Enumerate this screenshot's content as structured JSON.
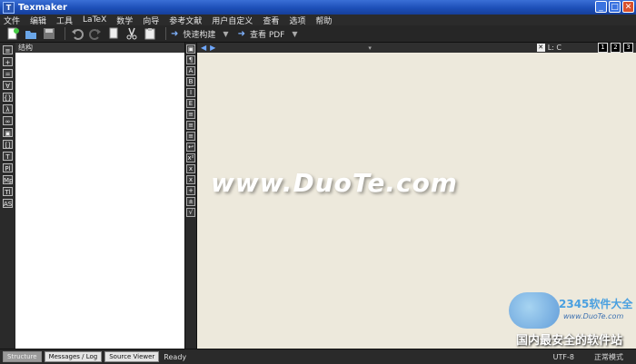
{
  "window": {
    "title": "Texmaker",
    "app_icon": "T",
    "min": "_",
    "max": "□",
    "close": "✕"
  },
  "menu": [
    "文件",
    "编辑",
    "工具",
    "LaTeX",
    "数学",
    "向导",
    "参考文献",
    "用户自定义",
    "查看",
    "选项",
    "帮助"
  ],
  "toolbar": {
    "icons": [
      "new-file-icon",
      "open-file-icon",
      "save-icon",
      "undo-icon",
      "redo-icon",
      "copy-icon",
      "cut-icon",
      "paste-icon"
    ],
    "quick_build": "快速构建",
    "view_pdf": "查看 PDF"
  },
  "structure": {
    "title": "结构"
  },
  "left_strip": [
    "≡",
    "+",
    "=",
    "∀",
    "{}",
    "λ",
    "∞",
    "▣",
    "[]",
    "T",
    "Pl",
    "Mp",
    "Tl",
    "AS"
  ],
  "mid_strip": [
    "▣",
    "¶",
    "A",
    "B",
    "I",
    "E",
    "≡",
    "≡",
    "≡",
    "↩",
    "x²",
    "x",
    "x",
    "+",
    "±",
    "√"
  ],
  "editor": {
    "pos_label": "L: C",
    "view_buttons": [
      "1",
      "2",
      "3"
    ]
  },
  "watermark": {
    "text": "www.DuoTe.com"
  },
  "logo": {
    "brand": "2345软件大全",
    "url": "www.DuoTe.com",
    "slogan": "国内最安全的软件站"
  },
  "statusbar": {
    "tabs": [
      "Structure",
      "Messages / Log",
      "Source Viewer"
    ],
    "ready": "Ready",
    "encoding": "UTF-8",
    "mode": "正常模式"
  }
}
